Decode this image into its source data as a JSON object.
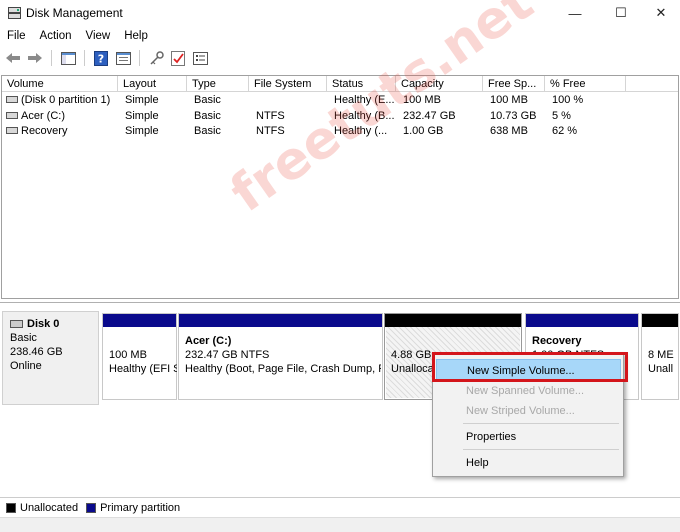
{
  "window": {
    "title": "Disk Management"
  },
  "window_controls": {
    "minimize": "—",
    "maximize": "☐",
    "close": "✕"
  },
  "menu": [
    "File",
    "Action",
    "View",
    "Help"
  ],
  "toolbar": {
    "icons": [
      "back-arrow-icon",
      "forward-arrow-icon",
      "console-tree-icon",
      "help-icon",
      "properties-icon",
      "key-icon",
      "checklist-icon",
      "list-view-icon"
    ]
  },
  "volume_table": {
    "columns": [
      "Volume",
      "Layout",
      "Type",
      "File System",
      "Status",
      "Capacity",
      "Free Sp...",
      "% Free"
    ],
    "rows": [
      [
        "(Disk 0 partition 1)",
        "Simple",
        "Basic",
        "",
        "Healthy (E...",
        "100 MB",
        "100 MB",
        "100 %"
      ],
      [
        "Acer (C:)",
        "Simple",
        "Basic",
        "NTFS",
        "Healthy (B...",
        "232.47 GB",
        "10.73 GB",
        "5 %"
      ],
      [
        "Recovery",
        "Simple",
        "Basic",
        "NTFS",
        "Healthy (...",
        "1.00 GB",
        "638 MB",
        "62 %"
      ]
    ]
  },
  "disk0": {
    "name": "Disk 0",
    "type": "Basic",
    "size": "238.46 GB",
    "status": "Online",
    "partitions": [
      {
        "title": "",
        "line1": "100 MB",
        "line2": "Healthy (EFI S"
      },
      {
        "title": "Acer  (C:)",
        "line1": "232.47 GB NTFS",
        "line2": "Healthy (Boot, Page File, Crash Dump, P"
      },
      {
        "title": "",
        "line1": "4.88 GB",
        "line2": "Unalloca"
      },
      {
        "title": "Recovery",
        "line1": "1.00 GB NTFS",
        "line2": ""
      },
      {
        "title": "",
        "line1": "8 ME",
        "line2": "Unall"
      }
    ]
  },
  "legend": {
    "unallocated": "Unallocated",
    "primary": "Primary partition"
  },
  "colors": {
    "primary": "#0a0a8c",
    "unallocated": "#000000",
    "highlight": "#a7d7f9",
    "callout": "#d4151b"
  },
  "context_menu": {
    "items": [
      {
        "label": "New Simple Volume...",
        "state": "highlighted"
      },
      {
        "label": "New Spanned Volume...",
        "state": "disabled"
      },
      {
        "label": "New Striped Volume...",
        "state": "disabled"
      },
      {
        "label": "Properties",
        "state": "enabled"
      },
      {
        "label": "Help",
        "state": "enabled"
      }
    ]
  },
  "watermark": {
    "text": "freetuts.net"
  }
}
